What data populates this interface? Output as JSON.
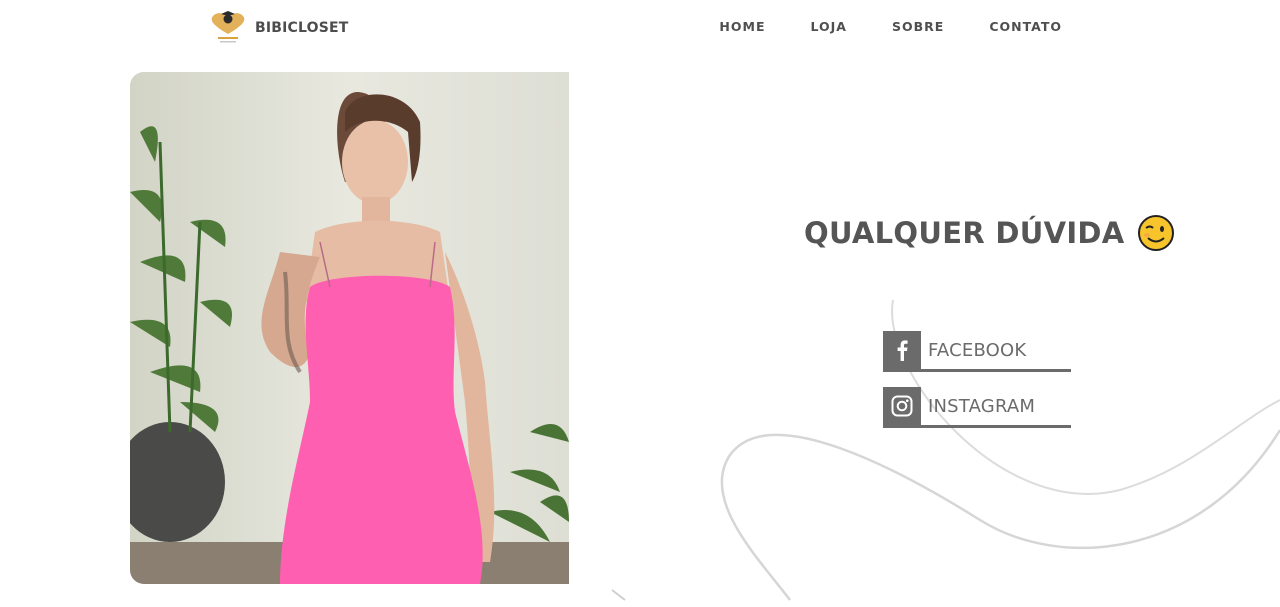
{
  "brand": {
    "name": "BIBICLOSET"
  },
  "nav": {
    "items": [
      "HOME",
      "LOJA",
      "SOBRE",
      "CONTATO"
    ]
  },
  "hero": {
    "media": "video-thumbnail-woman-pink-dress"
  },
  "contact": {
    "headline": "QUALQUER DÚVIDA",
    "emoji": "wink-emoji",
    "links": [
      {
        "label": "FACEBOOK",
        "icon": "facebook-icon"
      },
      {
        "label": "INSTAGRAM",
        "icon": "instagram-icon"
      }
    ]
  },
  "colors": {
    "text": "#4d4d4d",
    "social_gray": "#6b6b6b",
    "dress_pink": "#ff5fb0",
    "logo_gold": "#d9a23c",
    "curve_gray": "#d9d9d9"
  }
}
